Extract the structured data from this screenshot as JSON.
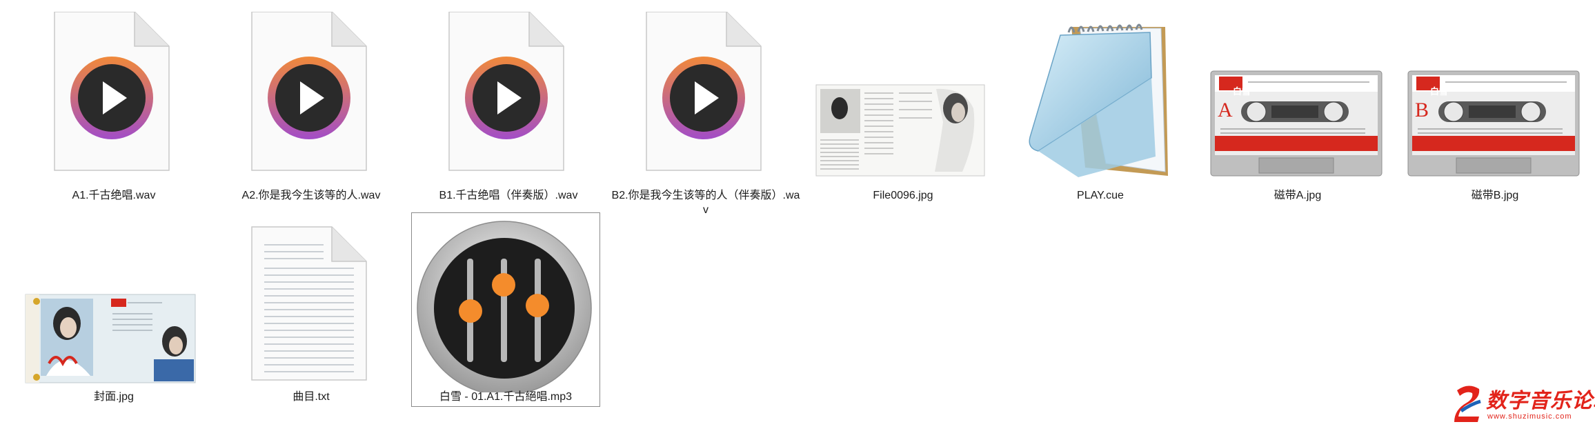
{
  "files": [
    {
      "name": "A1.千古绝唱.wav",
      "type": "audio-file"
    },
    {
      "name": "A2.你是我今生该等的人.wav",
      "type": "audio-file"
    },
    {
      "name": "B1.千古绝唱（伴奏版）.wav",
      "type": "audio-file"
    },
    {
      "name": "B2.你是我今生该等的人（伴奏版）.wav",
      "type": "audio-file"
    },
    {
      "name": "File0096.jpg",
      "type": "image-file"
    },
    {
      "name": "PLAY.cue",
      "type": "cue-file"
    },
    {
      "name": "磁带A.jpg",
      "type": "image-file"
    },
    {
      "name": "磁带B.jpg",
      "type": "image-file"
    },
    {
      "name": "封面.jpg",
      "type": "image-file"
    },
    {
      "name": "曲目.txt",
      "type": "text-file"
    },
    {
      "name": "白雪 - 01.A1.千古絕唱.mp3",
      "type": "mp3-file",
      "selected": true
    }
  ],
  "cassette": {
    "a_brand": "白雪",
    "a_side": "A",
    "b_brand": "白雪",
    "b_side": "B"
  },
  "watermark": {
    "title": "数字音乐论坛",
    "url": "www.shuzimusic.com"
  },
  "colors": {
    "accent_red": "#e2231a",
    "play_orange": "#f08a3c",
    "play_purple": "#a34fc6",
    "mixer_orange": "#f48c2c"
  }
}
